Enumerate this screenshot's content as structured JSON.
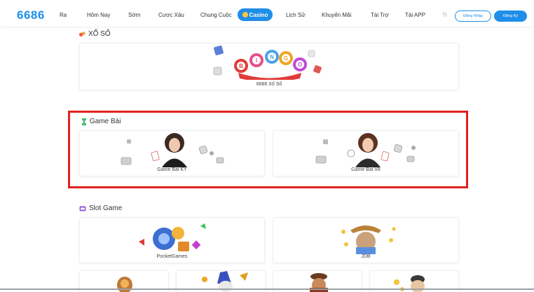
{
  "header": {
    "logo": "6686",
    "nav": [
      "Ra",
      "Hôm Nay",
      "Sớm",
      "Cược Xâu",
      "Chung Cuộc",
      "Casino",
      "Lịch Sử",
      "Khuyến Mãi",
      "Tài Trợ",
      "Tải APP",
      "Tr"
    ],
    "login_label": "Đăng Nhập",
    "register_label": "Đăng Ký"
  },
  "sections": {
    "xoso": {
      "title": "XỔ SỐ",
      "cards": [
        {
          "label": "6686 Xổ Số",
          "art_text": "BINGO"
        }
      ]
    },
    "gamebai": {
      "title": "Game Bài",
      "cards": [
        {
          "label": "Game Bài KY"
        },
        {
          "label": "Game Bài V8"
        }
      ]
    },
    "slot": {
      "title": "Slot Game",
      "cards": [
        {
          "label": "PocketGames"
        },
        {
          "label": "JDB"
        }
      ]
    }
  },
  "colors": {
    "brand": "#1f8ee8",
    "highlight": "#e0221e"
  }
}
